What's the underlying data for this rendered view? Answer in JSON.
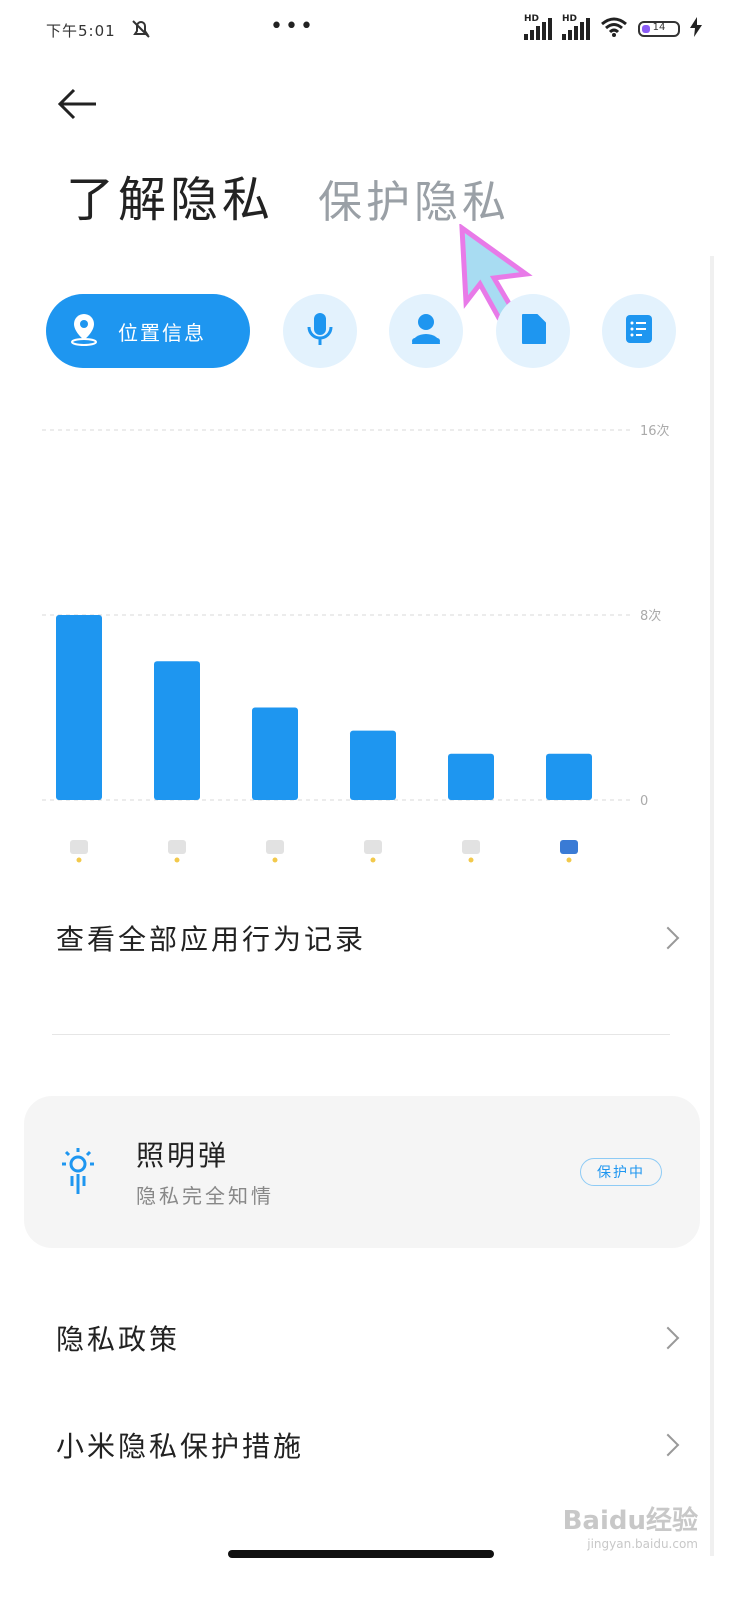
{
  "status_bar": {
    "time": "下午5:01",
    "network_1": "HD",
    "network_2": "HD",
    "battery_level": "14",
    "icons": [
      "mute-icon",
      "signal-icon",
      "wifi-icon",
      "battery-icon",
      "charging-icon"
    ]
  },
  "header": {
    "tab_active": "了解隐私",
    "tab_inactive": "保护隐私"
  },
  "categories": {
    "active_label": "位置信息",
    "active_icon": "location-icon",
    "others": [
      "microphone-icon",
      "contacts-icon",
      "storage-icon",
      "document-icon"
    ],
    "accent": "#1e96f0",
    "pill_bg": "#e3f2fd"
  },
  "chart_data": {
    "type": "bar",
    "categories": [
      "",
      "",
      "",
      "",
      "",
      ""
    ],
    "values": [
      8,
      6,
      4,
      3,
      2,
      2
    ],
    "ylim": [
      0,
      16
    ],
    "ticks": [
      {
        "value": 16,
        "label": "16次"
      },
      {
        "value": 8,
        "label": "8次"
      },
      {
        "value": 0,
        "label": "0"
      }
    ],
    "grid": true,
    "bar_color": "#1e96f0",
    "x_icons": [
      "app-icon-1",
      "app-icon-2",
      "app-icon-3",
      "app-icon-4",
      "app-icon-5",
      "app-icon-6"
    ]
  },
  "links": {
    "view_all": "查看全部应用行为记录",
    "privacy_policy": "隐私政策",
    "xiaomi_measures": "小米隐私保护措施"
  },
  "flare_card": {
    "title": "照明弹",
    "subtitle": "隐私完全知情",
    "badge": "保护中",
    "icon": "flare-icon"
  },
  "watermark": {
    "brand": "Baidu经验",
    "url": "jingyan.baidu.com"
  }
}
